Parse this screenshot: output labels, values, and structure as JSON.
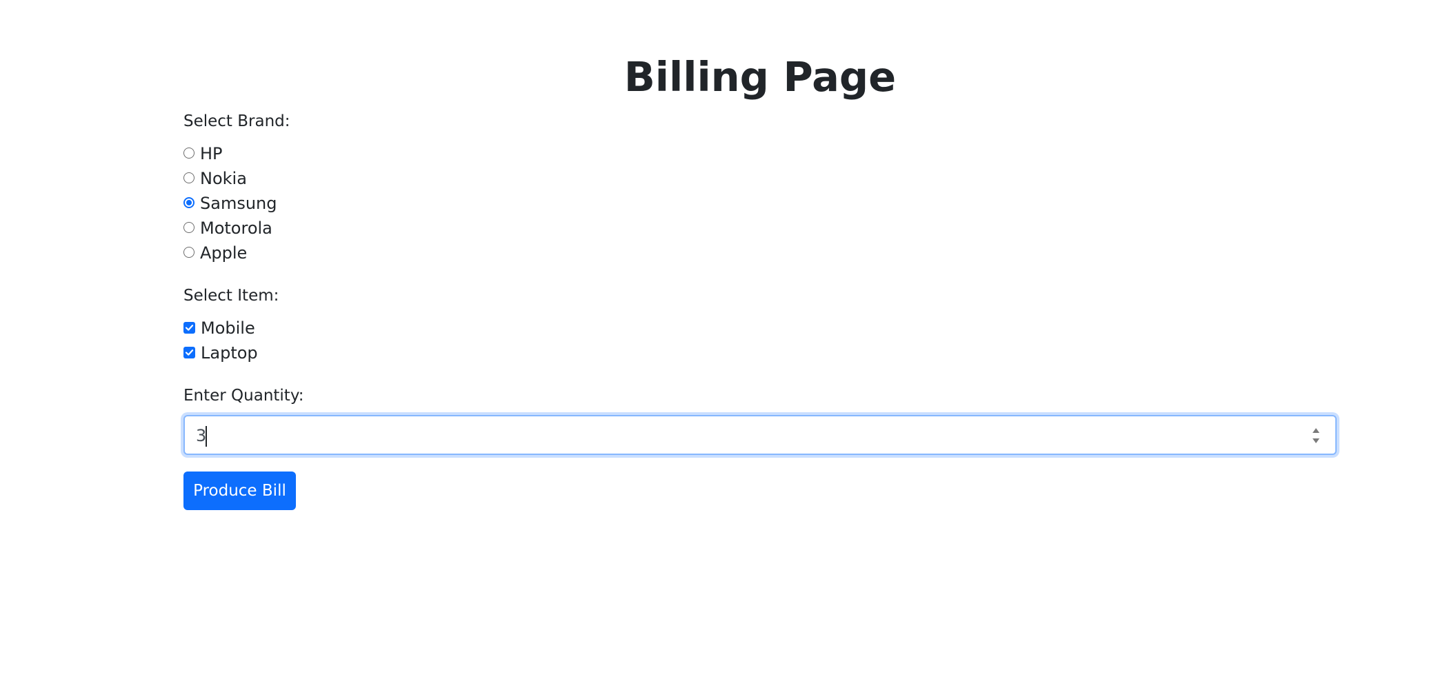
{
  "page": {
    "title": "Billing Page"
  },
  "brand": {
    "label": "Select Brand:",
    "options": [
      {
        "label": "HP",
        "checked": false
      },
      {
        "label": "Nokia",
        "checked": false
      },
      {
        "label": "Samsung",
        "checked": true
      },
      {
        "label": "Motorola",
        "checked": false
      },
      {
        "label": "Apple",
        "checked": false
      }
    ]
  },
  "item": {
    "label": "Select Item:",
    "options": [
      {
        "label": "Mobile",
        "checked": true
      },
      {
        "label": "Laptop",
        "checked": true
      }
    ]
  },
  "quantity": {
    "label": "Enter Quantity:",
    "value": "3"
  },
  "actions": {
    "produce_label": "Produce Bill"
  },
  "colors": {
    "accent": "#0d6efd",
    "text": "#212529"
  }
}
